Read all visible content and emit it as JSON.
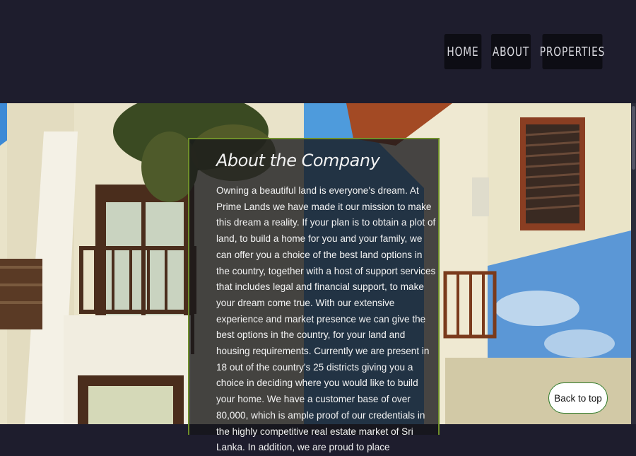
{
  "nav": {
    "items": [
      {
        "label": "HOME"
      },
      {
        "label": "ABOUT"
      },
      {
        "label": "PROPERTIES"
      }
    ]
  },
  "about": {
    "title": "About the Company",
    "body": "Owning a beautiful land is everyone's dream. At Prime Lands we have made it our mission to make this dream a reality. If your plan is to obtain a plot of land, to build a home for you and your family, we can offer you a choice of the best land options in the country, together with a host of support services that includes legal and financial support, to make your dream come true. With our extensive experience and market presence we can give the best options in the country, for your land and housing requirements. Currently we are present in 18 out of the country's 25 districts giving you a choice in deciding where you would like to build your home. We have a customer base of over 80,000, which is ample proof of our credentials in the highly competitive real estate market of Sri Lanka. In addition, we are proud to place"
  },
  "back_to_top": {
    "label": "Back to top"
  },
  "colors": {
    "header_bg": "#1e1d2d",
    "nav_button_bg": "#0d0d14",
    "card_border": "#6f8f2a",
    "back_to_top_border": "#2f7a2a"
  }
}
